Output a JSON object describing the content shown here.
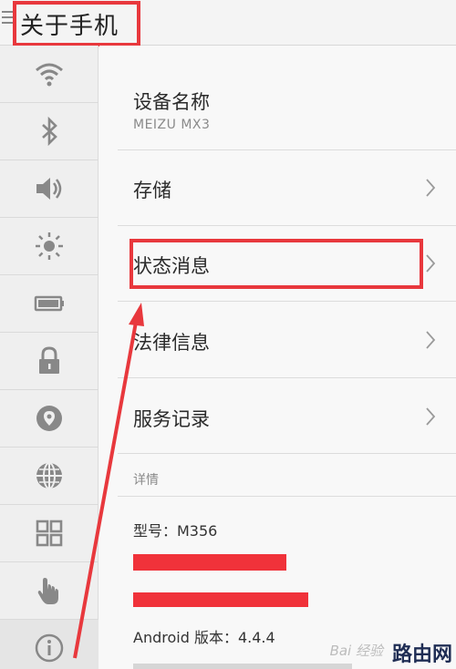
{
  "header": {
    "title": "关于手机"
  },
  "sidebar": {
    "items": [
      {
        "icon": "wifi-icon"
      },
      {
        "icon": "bluetooth-icon"
      },
      {
        "icon": "volume-icon"
      },
      {
        "icon": "brightness-icon"
      },
      {
        "icon": "battery-icon"
      },
      {
        "icon": "lock-icon"
      },
      {
        "icon": "location-icon"
      },
      {
        "icon": "globe-icon"
      },
      {
        "icon": "apps-grid-icon"
      },
      {
        "icon": "hand-icon"
      },
      {
        "icon": "info-icon",
        "active": true
      }
    ]
  },
  "main": {
    "device": {
      "label": "设备名称",
      "value": "MEIZU MX3"
    },
    "rows": [
      {
        "label": "存储"
      },
      {
        "label": "状态消息"
      },
      {
        "label": "法律信息"
      },
      {
        "label": "服务记录"
      }
    ],
    "details_header": "详情",
    "details": {
      "model": "型号：M356",
      "android_version": "Android 版本：4.4.4"
    }
  },
  "watermark": {
    "logo_text": "Bai 经验",
    "site": "路由网"
  },
  "colors": {
    "annotation_red": "#e8383d",
    "text": "#2b2b2b",
    "subtext": "#8a8a8a"
  }
}
